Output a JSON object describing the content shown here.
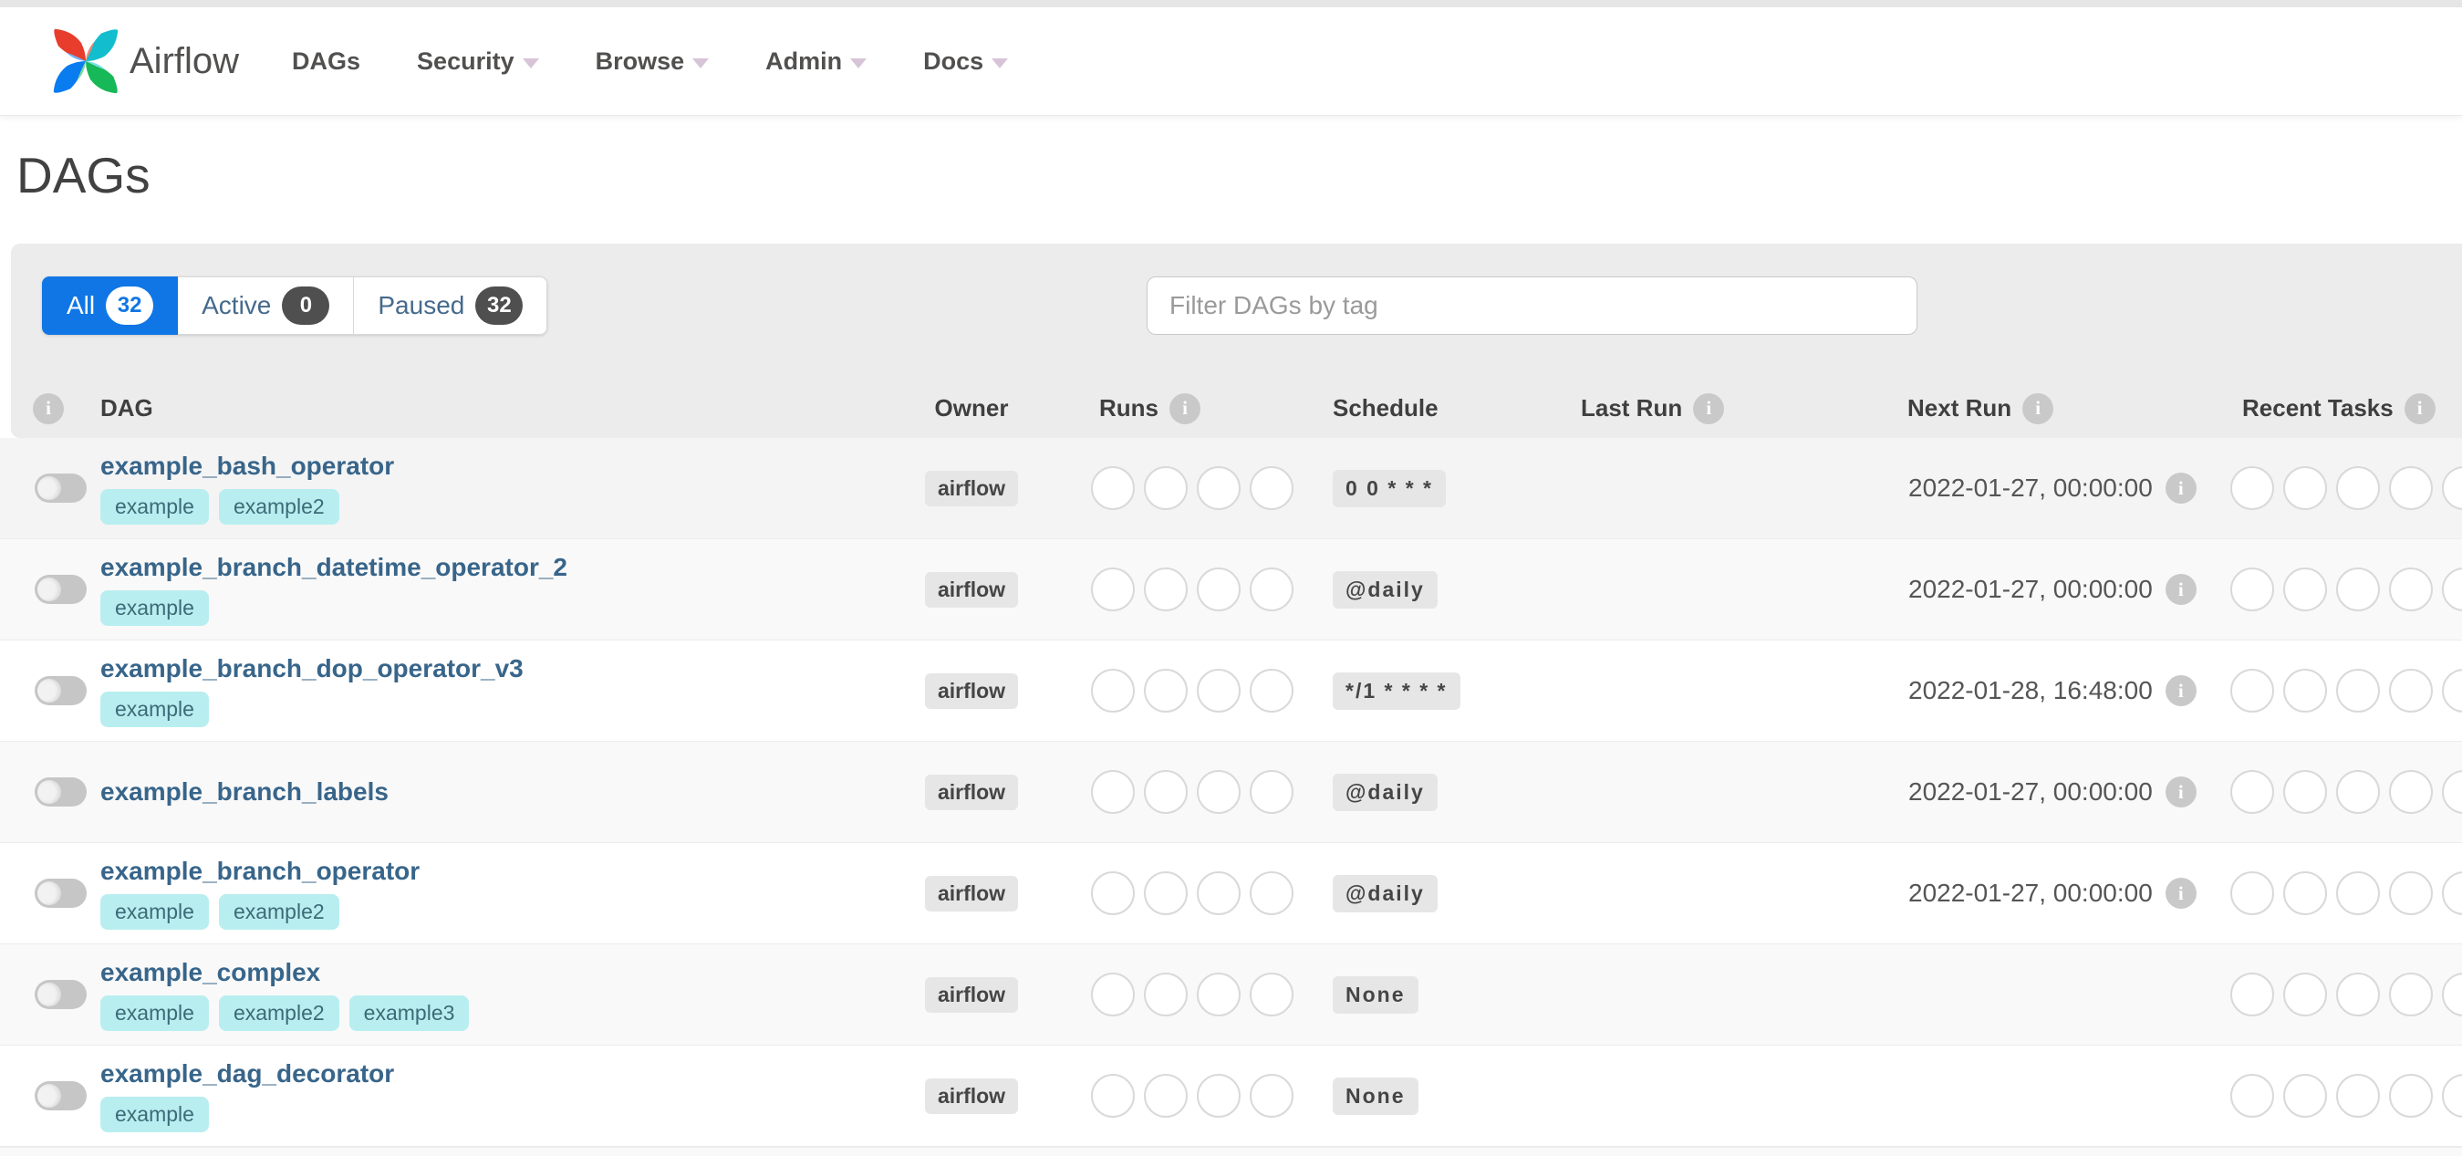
{
  "navbar": {
    "brand": "Airflow",
    "items": [
      {
        "label": "DAGs",
        "caret": false
      },
      {
        "label": "Security",
        "caret": true
      },
      {
        "label": "Browse",
        "caret": true
      },
      {
        "label": "Admin",
        "caret": true
      },
      {
        "label": "Docs",
        "caret": true
      }
    ]
  },
  "page": {
    "title": "DAGs"
  },
  "tabs": [
    {
      "label": "All",
      "count": "32",
      "active": true
    },
    {
      "label": "Active",
      "count": "0",
      "active": false
    },
    {
      "label": "Paused",
      "count": "32",
      "active": false
    }
  ],
  "filter": {
    "placeholder": "Filter DAGs by tag"
  },
  "table": {
    "headers": {
      "dag": "DAG",
      "owner": "Owner",
      "runs": "Runs",
      "schedule": "Schedule",
      "last_run": "Last Run",
      "next_run": "Next Run",
      "recent_tasks": "Recent Tasks"
    },
    "runs_slots": 4,
    "recent_slots": 5,
    "rows": [
      {
        "name": "example_bash_operator",
        "tags": [
          "example",
          "example2"
        ],
        "owner": "airflow",
        "schedule": "0 0 * * *",
        "last_run": "",
        "next_run": "2022-01-27, 00:00:00",
        "toggle_on": false,
        "highlighted": true,
        "has_runs": true,
        "has_recent": true
      },
      {
        "name": "example_branch_datetime_operator_2",
        "tags": [
          "example"
        ],
        "owner": "airflow",
        "schedule": "@daily",
        "last_run": "",
        "next_run": "2022-01-27, 00:00:00",
        "toggle_on": false,
        "highlighted": false,
        "has_runs": true,
        "has_recent": true
      },
      {
        "name": "example_branch_dop_operator_v3",
        "tags": [
          "example"
        ],
        "owner": "airflow",
        "schedule": "*/1 * * * *",
        "last_run": "",
        "next_run": "2022-01-28, 16:48:00",
        "toggle_on": false,
        "highlighted": false,
        "has_runs": true,
        "has_recent": true
      },
      {
        "name": "example_branch_labels",
        "tags": [],
        "owner": "airflow",
        "schedule": "@daily",
        "last_run": "",
        "next_run": "2022-01-27, 00:00:00",
        "toggle_on": false,
        "highlighted": false,
        "has_runs": true,
        "has_recent": true
      },
      {
        "name": "example_branch_operator",
        "tags": [
          "example",
          "example2"
        ],
        "owner": "airflow",
        "schedule": "@daily",
        "last_run": "",
        "next_run": "2022-01-27, 00:00:00",
        "toggle_on": false,
        "highlighted": false,
        "has_runs": true,
        "has_recent": true
      },
      {
        "name": "example_complex",
        "tags": [
          "example",
          "example2",
          "example3"
        ],
        "owner": "airflow",
        "schedule": "None",
        "last_run": "",
        "next_run": "",
        "toggle_on": false,
        "highlighted": false,
        "has_runs": true,
        "has_recent": true
      },
      {
        "name": "example_dag_decorator",
        "tags": [
          "example"
        ],
        "owner": "airflow",
        "schedule": "None",
        "last_run": "",
        "next_run": "",
        "toggle_on": false,
        "highlighted": false,
        "has_runs": true,
        "has_recent": true
      }
    ]
  },
  "colors": {
    "accent_blue": "#1076e5",
    "brand_text": "#51504f",
    "dag_link": "#38658a",
    "tag_bg": "#b9eef0",
    "tag_text": "#3c6b78",
    "badge_bg": "#e6e6e6",
    "badge_dark": "#4f4f4f",
    "panel_bg": "#ececec",
    "row_stripe": "#f9f9f9",
    "row_hover": "#f4f4f4",
    "circle_border": "#d9d9d9",
    "info_icon_bg": "#c9c9c9",
    "nav_caret": "#d8c4d8",
    "logo_red": "#e83d2c",
    "logo_cyan": "#12bdcd",
    "logo_green": "#16b857",
    "logo_blue": "#097cf0"
  }
}
